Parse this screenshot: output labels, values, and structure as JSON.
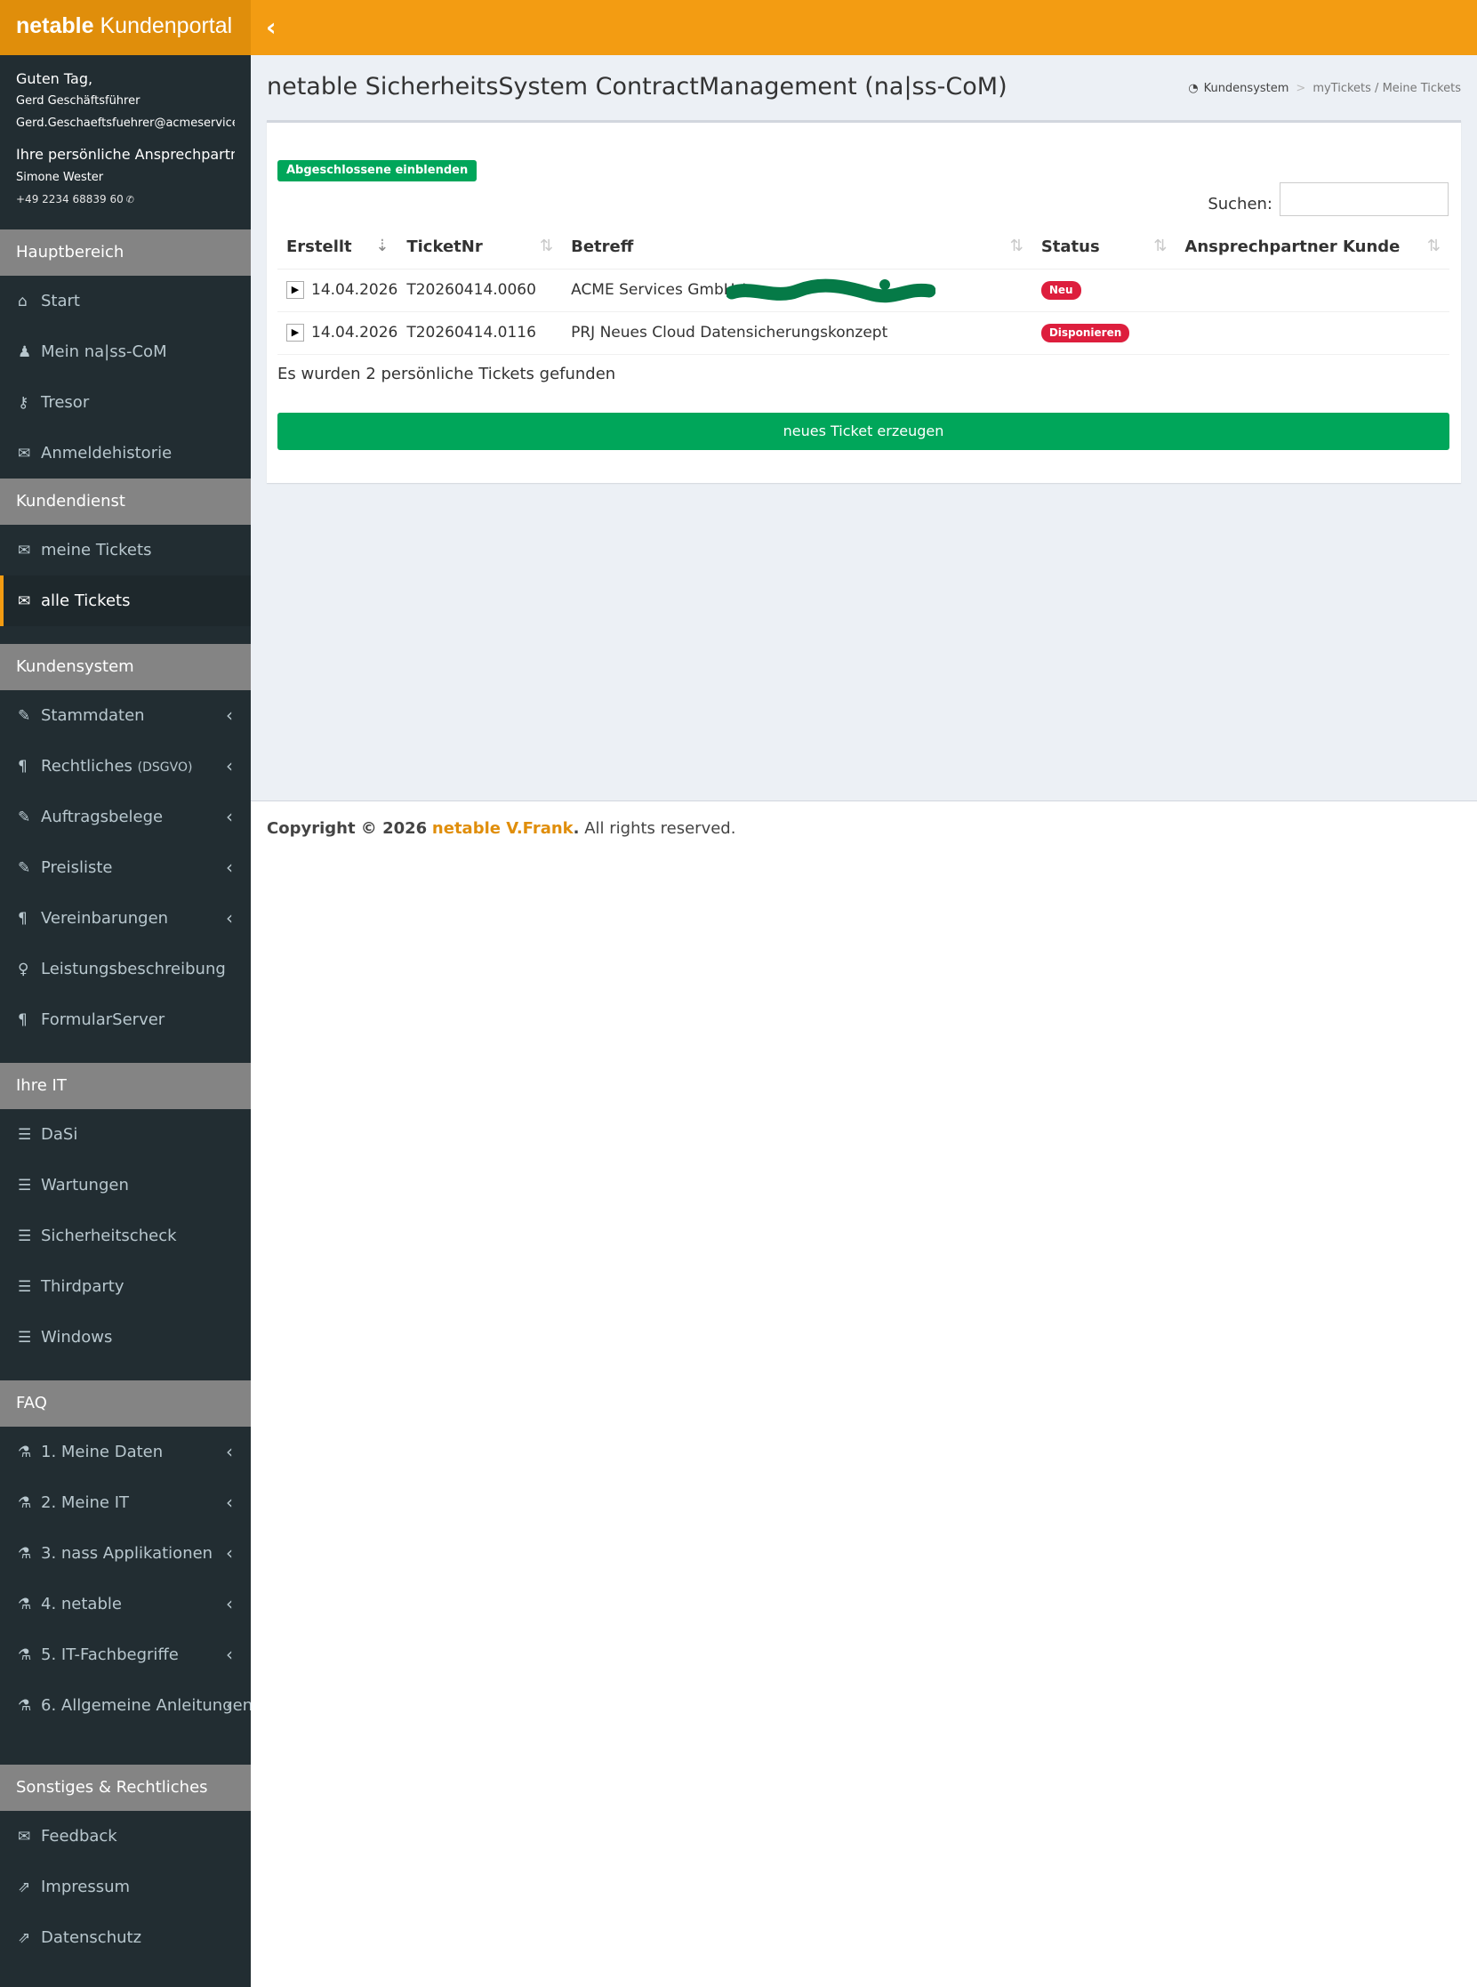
{
  "logo": {
    "bold": "netable",
    "text": "Kundenportal"
  },
  "user": {
    "greeting": "Guten Tag,",
    "name": "Gerd Geschäftsführer",
    "email": "Gerd.Geschaeftsfuehrer@acmeservices.de",
    "contact_heading": "Ihre persönliche Ansprechpartnerin",
    "contact_name": "Simone Wester",
    "contact_phone": "+49 2234 68839 60"
  },
  "sidebar": {
    "hauptbereich": {
      "header": "Hauptbereich",
      "items": [
        {
          "label": "Start",
          "icon": "home-icon"
        },
        {
          "label": "Mein na|ss-CoM",
          "icon": "user-icon"
        },
        {
          "label": "Tresor",
          "icon": "key-icon"
        },
        {
          "label": "Anmeldehistorie",
          "icon": "comment-icon"
        }
      ]
    },
    "kundendienst": {
      "header": "Kundendienst",
      "items": [
        {
          "label": "meine Tickets",
          "icon": "envelope-open-icon"
        },
        {
          "label": "alle Tickets",
          "icon": "envelope-open-icon"
        }
      ]
    },
    "kundensystem": {
      "header": "Kundensystem",
      "items": [
        {
          "label": "Stammdaten",
          "icon": "edit-icon"
        },
        {
          "label": "Rechtliches",
          "suffix": "(DSGVO)",
          "icon": "paragraph-icon"
        },
        {
          "label": "Auftragsbelege",
          "icon": "edit-icon"
        },
        {
          "label": "Preisliste",
          "icon": "edit-icon"
        },
        {
          "label": "Vereinbarungen",
          "icon": "paragraph-icon"
        },
        {
          "label": "Leistungsbeschreibung",
          "icon": "lightbulb-icon"
        },
        {
          "label": "FormularServer",
          "icon": "paragraph-icon"
        }
      ]
    },
    "ihre_it": {
      "header": "Ihre IT",
      "items": [
        {
          "label": "DaSi",
          "icon": "server-icon"
        },
        {
          "label": "Wartungen",
          "icon": "server-icon"
        },
        {
          "label": "Sicherheitscheck",
          "icon": "server-icon"
        },
        {
          "label": "Thirdparty",
          "icon": "server-icon"
        },
        {
          "label": "Windows",
          "icon": "server-icon"
        }
      ]
    },
    "faq": {
      "header": "FAQ",
      "items": [
        {
          "label": "1. Meine Daten",
          "icon": "flask-icon"
        },
        {
          "label": "2. Meine IT",
          "icon": "flask-icon"
        },
        {
          "label": "3. nass Applikationen",
          "icon": "flask-icon"
        },
        {
          "label": "4. netable",
          "icon": "flask-icon"
        },
        {
          "label": "5. IT-Fachbegriffe",
          "icon": "flask-icon"
        },
        {
          "label": "6. Allgemeine Anleitungen",
          "icon": "flask-icon"
        }
      ]
    },
    "sonstiges": {
      "header": "Sonstiges & Rechtliches",
      "items": [
        {
          "label": "Feedback",
          "icon": "comment-icon"
        },
        {
          "label": "Impressum",
          "icon": "external-link-icon"
        },
        {
          "label": "Datenschutz",
          "icon": "external-link-icon"
        }
      ]
    }
  },
  "page": {
    "title": "netable SicherheitsSystem ContractManagement (na|ss-CoM)",
    "breadcrumb": [
      "Kundensystem",
      "myTickets / Meine Tickets"
    ]
  },
  "tickets": {
    "toggle_closed_label": "Abgeschlossene einblenden",
    "search_label": "Suchen:",
    "search_value": "",
    "columns": [
      "Erstellt",
      "TicketNr",
      "Betreff",
      "Status",
      "Ansprechpartner Kunde"
    ],
    "rows": [
      {
        "created": "14.04.2026",
        "number": "T20260414.0060",
        "subject": "ACME Services GmbH /",
        "status": "Neu",
        "contact": ""
      },
      {
        "created": "14.04.2026",
        "number": "T20260414.0116",
        "subject": "PRJ Neues Cloud Datensicherungskonzept",
        "status": "Disponieren",
        "contact": ""
      }
    ],
    "found_text": "Es wurden 2 persönliche Tickets gefunden",
    "new_button": "neues Ticket erzeugen"
  },
  "footer": {
    "prefix": "Copyright © 2026",
    "brand": "netable V.Frank",
    "suffix": "All rights reserved."
  },
  "colors": {
    "accent": "#f39c12",
    "sidebar": "#222d32",
    "section_header": "#848484",
    "success": "#00a65a",
    "danger": "#dd1e3d"
  }
}
